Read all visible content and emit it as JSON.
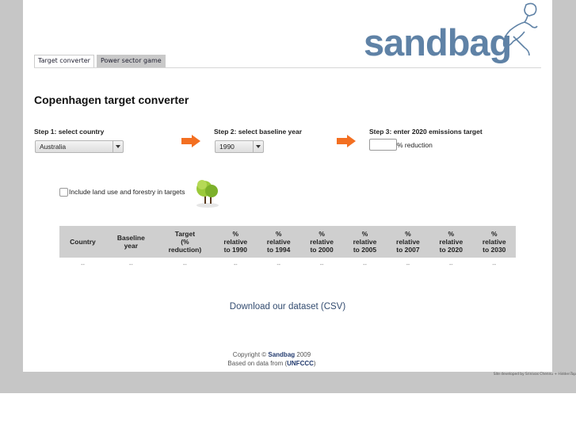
{
  "tabs": [
    {
      "label": "Target converter",
      "active": true
    },
    {
      "label": "Power sector game",
      "active": false
    }
  ],
  "logo": {
    "text": "sandbag",
    "color": "#5f82a6",
    "icon": "person-carrying-sandbag-icon"
  },
  "page_title": "Copenhagen target converter",
  "steps": {
    "step1": {
      "label": "Step 1: select country",
      "selected": "Australia"
    },
    "step2": {
      "label": "Step 2: select baseline year",
      "selected": "1990"
    },
    "step3": {
      "label": "Step 3: enter 2020 emissions target",
      "value": "",
      "suffix": "% reduction"
    }
  },
  "accent_color": "#f36f21",
  "land_use": {
    "label": "Include land use and forestry in targets",
    "checked": false,
    "icon": "tree-icon"
  },
  "table": {
    "headers": [
      [
        "Country"
      ],
      [
        "Baseline",
        "year"
      ],
      [
        "Target",
        "(%",
        "reduction)"
      ],
      [
        "%",
        "relative",
        "to 1990"
      ],
      [
        "%",
        "relative",
        "to 1994"
      ],
      [
        "%",
        "relative",
        "to 2000"
      ],
      [
        "%",
        "relative",
        "to 2005"
      ],
      [
        "%",
        "relative",
        "to 2007"
      ],
      [
        "%",
        "relative",
        "to 2020"
      ],
      [
        "%",
        "relative",
        "to 2030"
      ]
    ],
    "rows": [
      [
        "--",
        "--",
        "--",
        "--",
        "--",
        "--",
        "--",
        "--",
        "--",
        "--"
      ]
    ]
  },
  "download_link": "Download our dataset (CSV)",
  "footer": {
    "copyright_prefix": "Copyright © ",
    "copyright_link": "Sandbag",
    "copyright_suffix": " 2009",
    "source_prefix": "Based on data from (",
    "source_link": "UNFCCC",
    "source_suffix": ")"
  },
  "credit": "Site developed by Srinivas Chennu + HiddenTop"
}
